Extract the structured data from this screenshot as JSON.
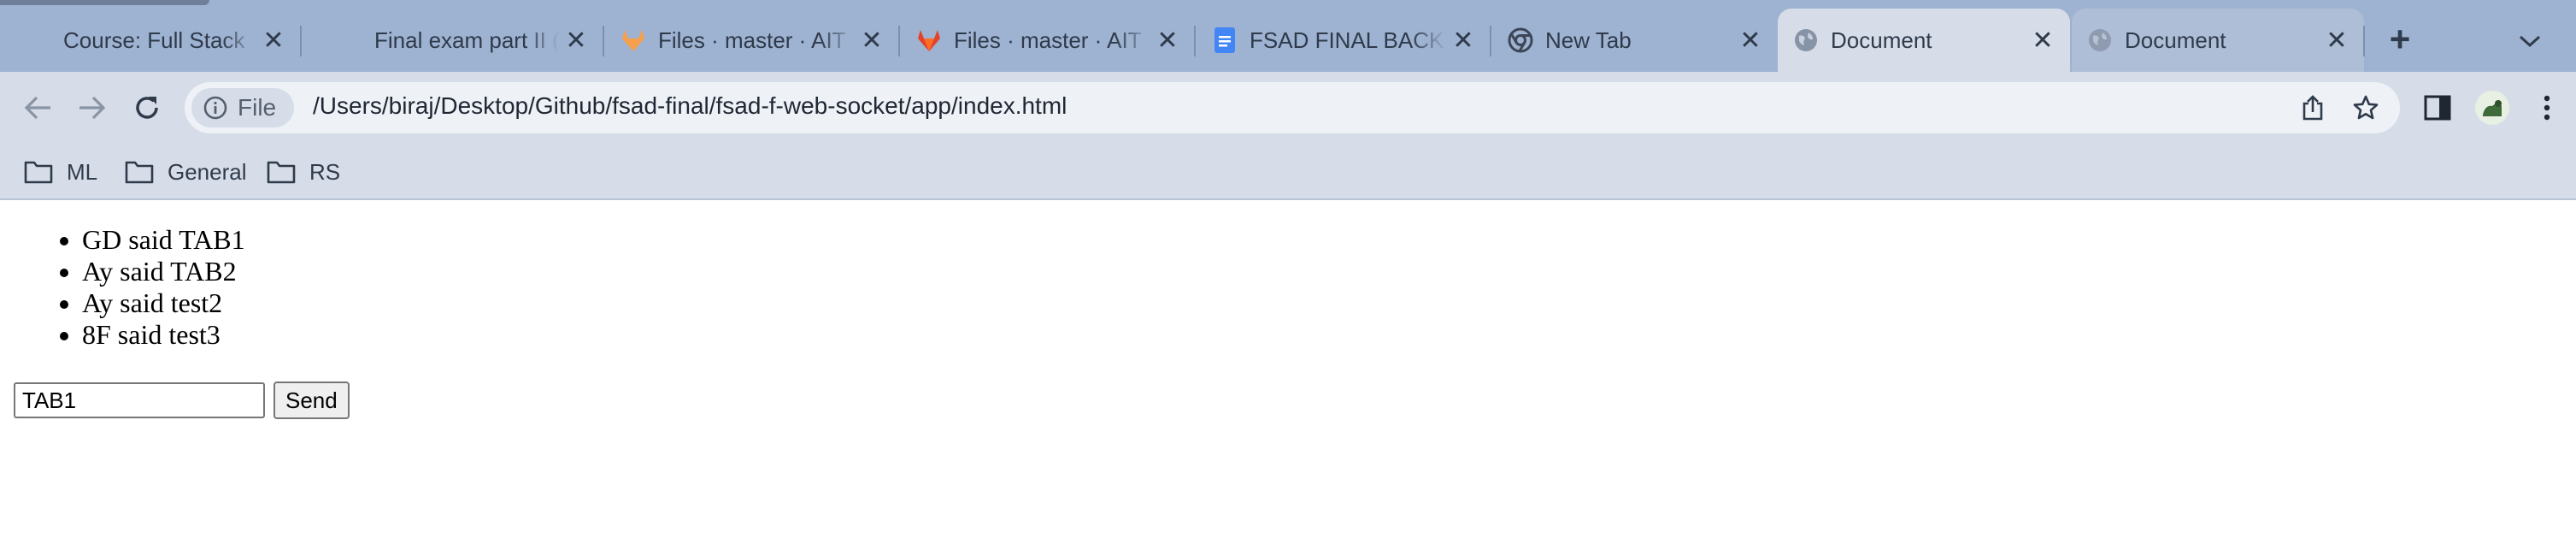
{
  "tabs": [
    {
      "title": "Course: Full Stack",
      "icon": "blank-favicon-icon"
    },
    {
      "title": "Final exam part II (",
      "icon": "blank-favicon-icon"
    },
    {
      "title": "Files · master · AIT",
      "icon": "gitlab-icon"
    },
    {
      "title": "Files · master · AIT",
      "icon": "gitlab-icon"
    },
    {
      "title": "FSAD FINAL BACK",
      "icon": "google-docs-icon"
    },
    {
      "title": "New Tab",
      "icon": "chrome-icon"
    },
    {
      "title": "Document",
      "icon": "globe-icon",
      "active": true
    },
    {
      "title": "Document",
      "icon": "globe-icon"
    }
  ],
  "toolbar": {
    "scheme_label": "File",
    "url": "/Users/biraj/Desktop/Github/fsad-final/fsad-f-web-socket/app/index.html"
  },
  "bookmarks": [
    {
      "label": "ML"
    },
    {
      "label": "General"
    },
    {
      "label": "RS"
    }
  ],
  "page": {
    "messages": [
      "GD said TAB1",
      "Ay said TAB2",
      "Ay said test2",
      "8F said test3"
    ],
    "input_value": "TAB1",
    "send_label": "Send"
  },
  "colors": {
    "tabstrip": "#9eb3d1",
    "toolbar": "#d6dde8",
    "gitlab_orange": "#e2432a",
    "docs_blue": "#4285f4"
  }
}
